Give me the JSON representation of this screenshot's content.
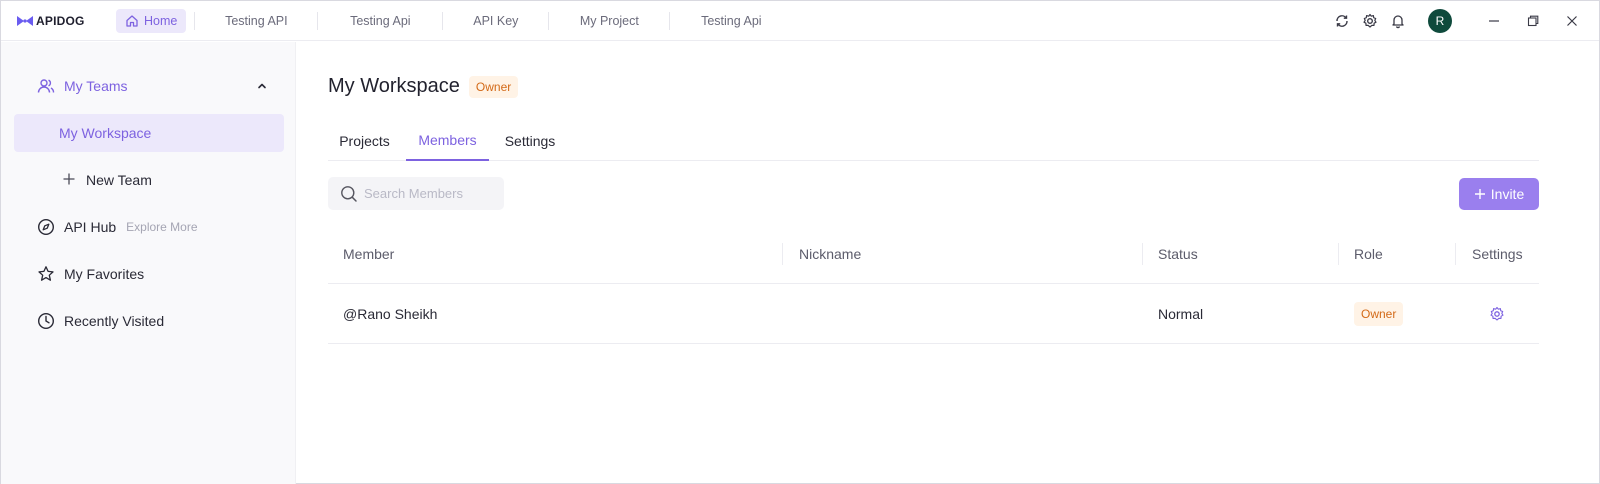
{
  "app": {
    "logo_text": "APIDOG"
  },
  "topbar": {
    "tabs": [
      {
        "label": "Home"
      },
      {
        "label": "Testing API"
      },
      {
        "label": "Testing Api"
      },
      {
        "label": "API Key"
      },
      {
        "label": "My Project"
      },
      {
        "label": "Testing Api"
      }
    ],
    "avatar_initial": "R"
  },
  "sidebar": {
    "teams_label": "My Teams",
    "workspace_label": "My Workspace",
    "new_team_label": "New Team",
    "api_hub_label": "API Hub",
    "api_hub_hint": "Explore More",
    "favorites_label": "My Favorites",
    "recent_label": "Recently Visited"
  },
  "main": {
    "title": "My Workspace",
    "title_badge": "Owner",
    "tabs": [
      {
        "label": "Projects"
      },
      {
        "label": "Members"
      },
      {
        "label": "Settings"
      }
    ],
    "active_tab": "Members",
    "search_placeholder": "Search Members",
    "invite_label": "Invite"
  },
  "table": {
    "headers": [
      "Member",
      "Nickname",
      "Status",
      "Role",
      "Settings"
    ],
    "rows": [
      {
        "member": "@Rano Sheikh",
        "nickname": "",
        "status": "Normal",
        "role": "Owner"
      }
    ]
  },
  "colors": {
    "accent": "#7d62e0",
    "accent_light": "#ece8fb",
    "owner_badge_bg": "#fff3e6",
    "owner_badge_text": "#d36a18",
    "avatar_bg": "#0f4a3c"
  }
}
